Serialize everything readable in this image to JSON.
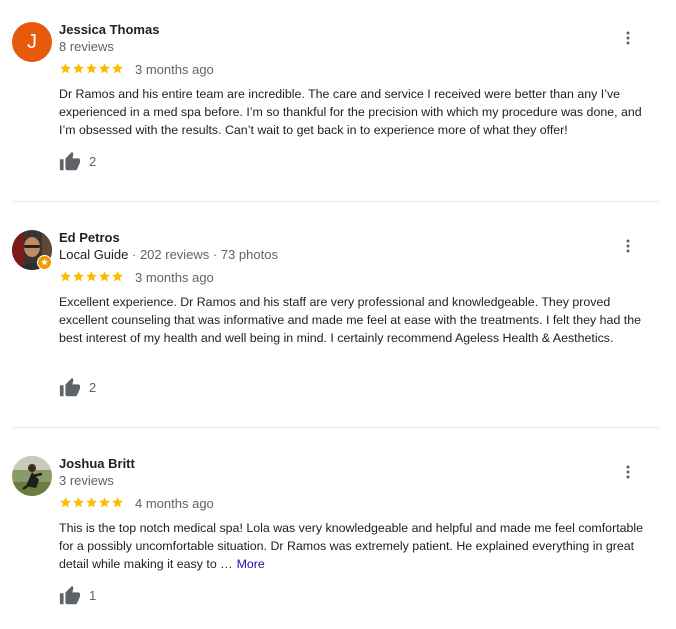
{
  "colors": {
    "star": "#fbbc04",
    "avatar_letter_bg": "#e8590c",
    "guide_badge": "#f29900",
    "link": "#1a0dab",
    "muted": "#5f6368",
    "text": "#202124"
  },
  "reviews": [
    {
      "author": "Jessica Thomas",
      "avatar_letter": "J",
      "meta": "8 reviews",
      "rating": 5,
      "time": "3 months ago",
      "text": "Dr Ramos and his entire team are incredible. The care and service I received were better than any I’ve experienced in a med spa before. I’m so thankful for the precision with which my procedure was done, and I’m obsessed with the results. Can’t wait to get back in to experience more of what they offer!",
      "likes": "2"
    },
    {
      "author": "Ed Petros",
      "guide_label": "Local Guide",
      "meta": " · 202 reviews · 73 photos",
      "rating": 5,
      "time": "3 months ago",
      "text": "Excellent experience. Dr Ramos and his staff are very professional and knowledgeable. They proved excellent counseling that was informative and made me feel at ease with the treatments. I felt they had the best interest of my health and well being in mind. I certainly recommend Ageless Health & Aesthetics.",
      "likes": "2"
    },
    {
      "author": "Joshua Britt",
      "meta": "3 reviews",
      "rating": 5,
      "time": "4 months ago",
      "text": "This is the top notch medical spa! Lola was very knowledgeable and helpful and made me feel comfortable for a possibly uncomfortable situation. Dr Ramos was extremely patient. He explained everything in great detail while making it easy to …",
      "more_label": "More",
      "likes": "1"
    }
  ]
}
